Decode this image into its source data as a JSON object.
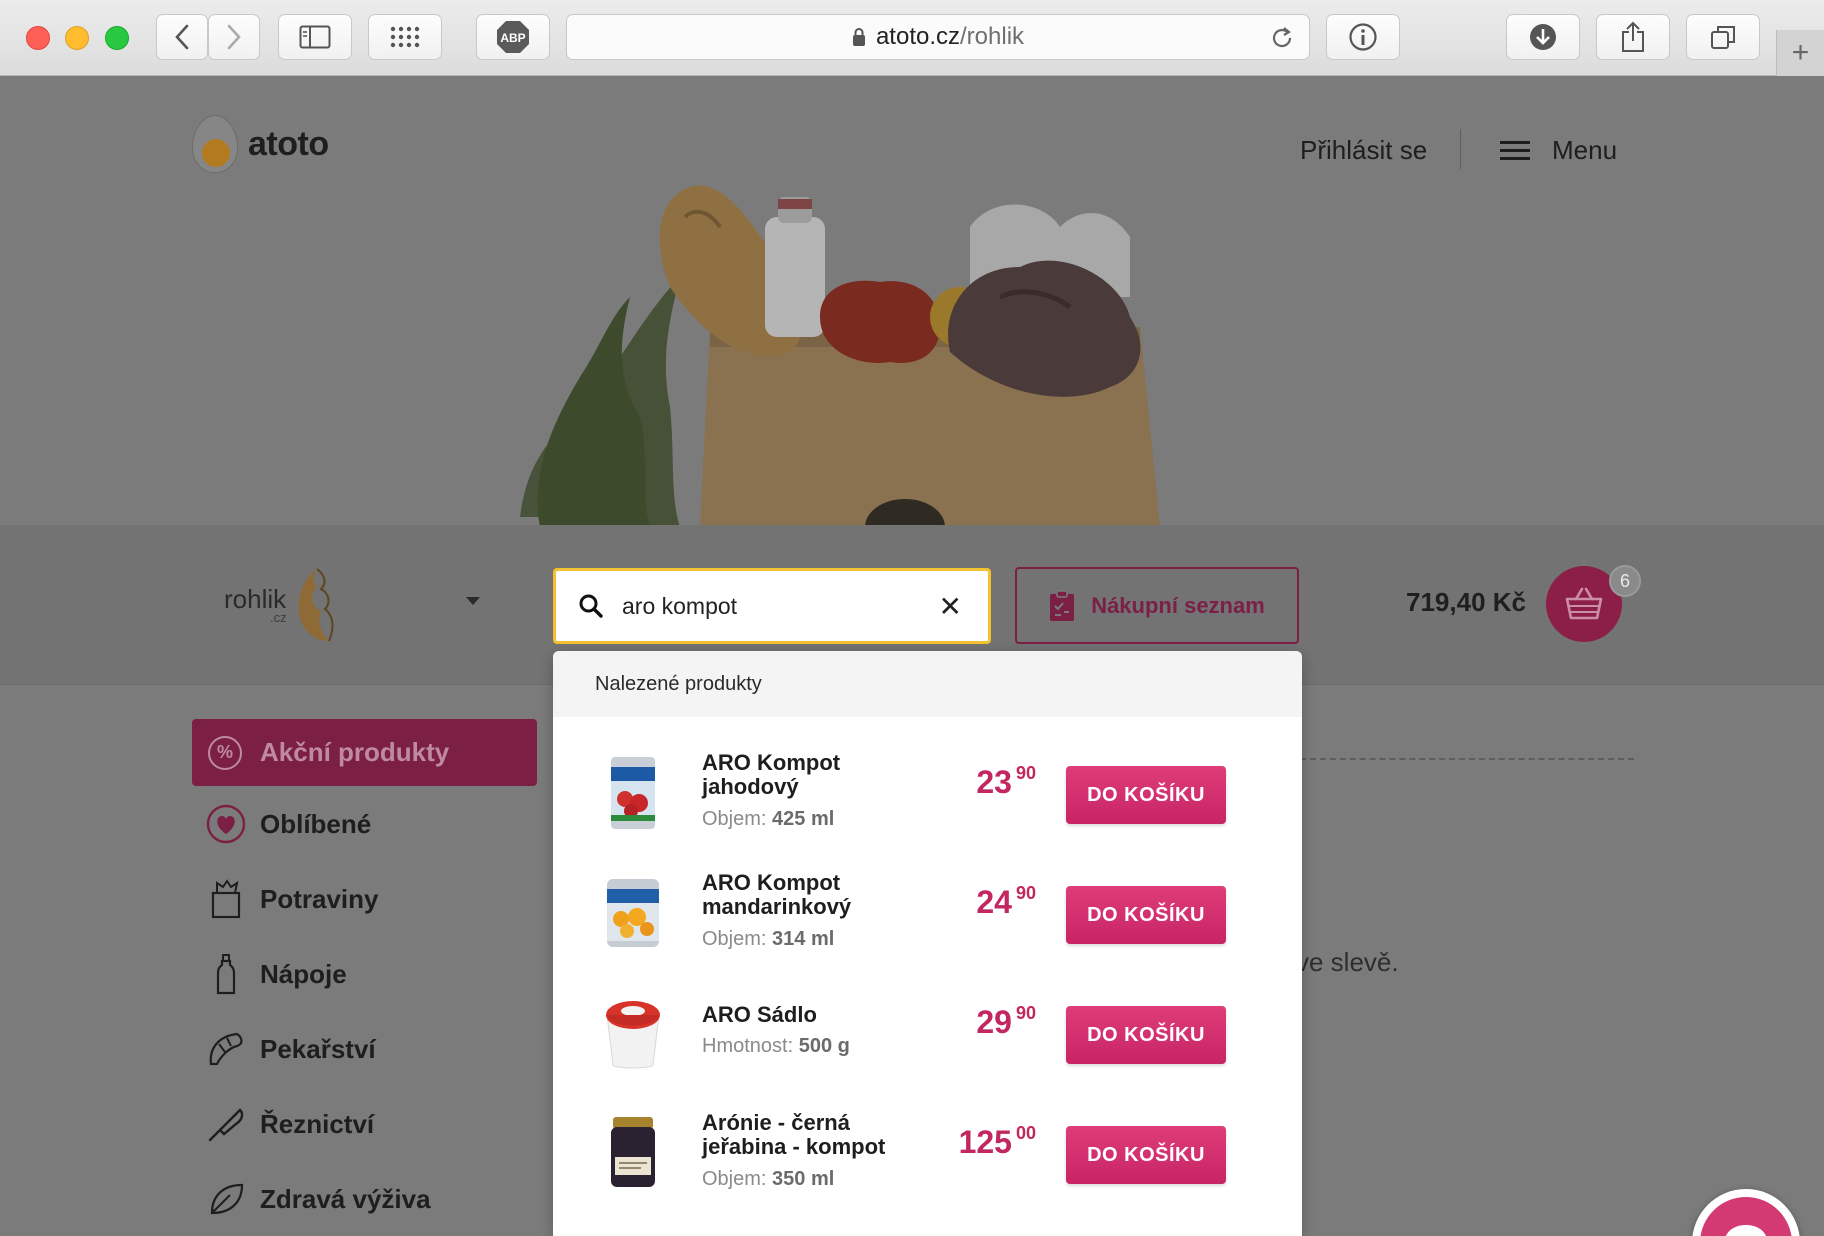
{
  "browser": {
    "url_host": "atoto.cz",
    "url_path": "/rohlik",
    "buttons": [
      "back",
      "forward",
      "sidebar",
      "top-sites",
      "adblock",
      "info",
      "downloads",
      "share",
      "tabs",
      "new-tab"
    ],
    "adblock_label": "ABP",
    "new_tab_label": "+"
  },
  "header": {
    "logo_text": "atoto",
    "login_label": "Přihlásit se",
    "menu_label": "Menu"
  },
  "shop": {
    "name": "rohlik",
    "suffix": ".cz"
  },
  "search": {
    "value": "aro kompot",
    "clear_label": "✕"
  },
  "shopping_list_label": "Nákupní seznam",
  "cart": {
    "total": "719,40 Kč",
    "count": "6"
  },
  "sidebar": {
    "active": {
      "label": "Akční produkty",
      "icon": "percent-icon"
    },
    "items": [
      {
        "label": "Oblíbené",
        "icon": "heart-icon"
      },
      {
        "label": "Potraviny",
        "icon": "grocery-bag-icon"
      },
      {
        "label": "Nápoje",
        "icon": "bottle-icon"
      },
      {
        "label": "Pekařství",
        "icon": "croissant-icon"
      },
      {
        "label": "Řeznictví",
        "icon": "knife-icon"
      },
      {
        "label": "Zdravá výživa",
        "icon": "leaf-icon"
      }
    ]
  },
  "background_text": "ve slevě.",
  "dropdown": {
    "heading": "Nalezené produkty",
    "add_label": "DO KOŠÍKU",
    "products": [
      {
        "name": "ARO Kompot jahodový",
        "meta_label": "Objem:",
        "meta_value": "425 ml",
        "price_int": "23",
        "price_dec": "90"
      },
      {
        "name": "ARO Kompot mandarinkový",
        "meta_label": "Objem:",
        "meta_value": "314 ml",
        "price_int": "24",
        "price_dec": "90"
      },
      {
        "name": "ARO Sádlo",
        "meta_label": "Hmotnost:",
        "meta_value": "500 g",
        "price_int": "29",
        "price_dec": "90"
      },
      {
        "name": "Arónie - černá jeřabina - kompot",
        "meta_label": "Objem:",
        "meta_value": "350 ml",
        "price_int": "125",
        "price_dec": "00"
      }
    ]
  },
  "colors": {
    "brand": "#c2275f",
    "search_focus": "#f2c230"
  }
}
